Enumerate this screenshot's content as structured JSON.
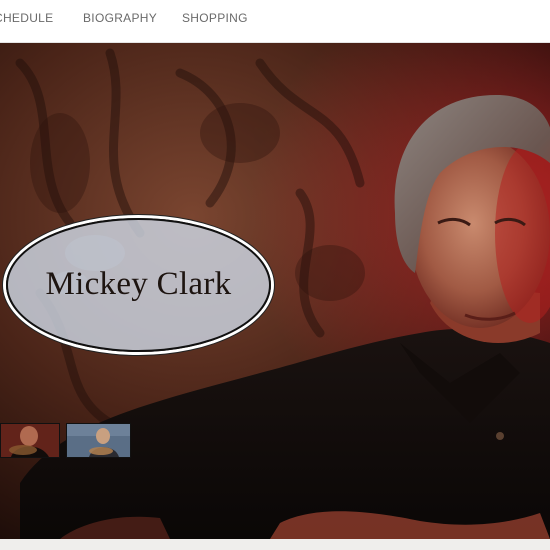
{
  "nav": {
    "schedule_label": "CHEDULE",
    "biography_label": "BIOGRAPHY",
    "shopping_label": "SHOPPING"
  },
  "hero": {
    "title": "Mickey Clark"
  },
  "colors": {
    "nav_text": "#6a6a6a",
    "oval_fill": "#cdd7e4",
    "title_text": "#1d1410",
    "shirt": "#0f0b0a",
    "background_warm": "#5a2a1c"
  },
  "thumbnails": [
    {
      "name": "thumbnail-performer-guitar"
    },
    {
      "name": "thumbnail-performer-stage"
    }
  ]
}
